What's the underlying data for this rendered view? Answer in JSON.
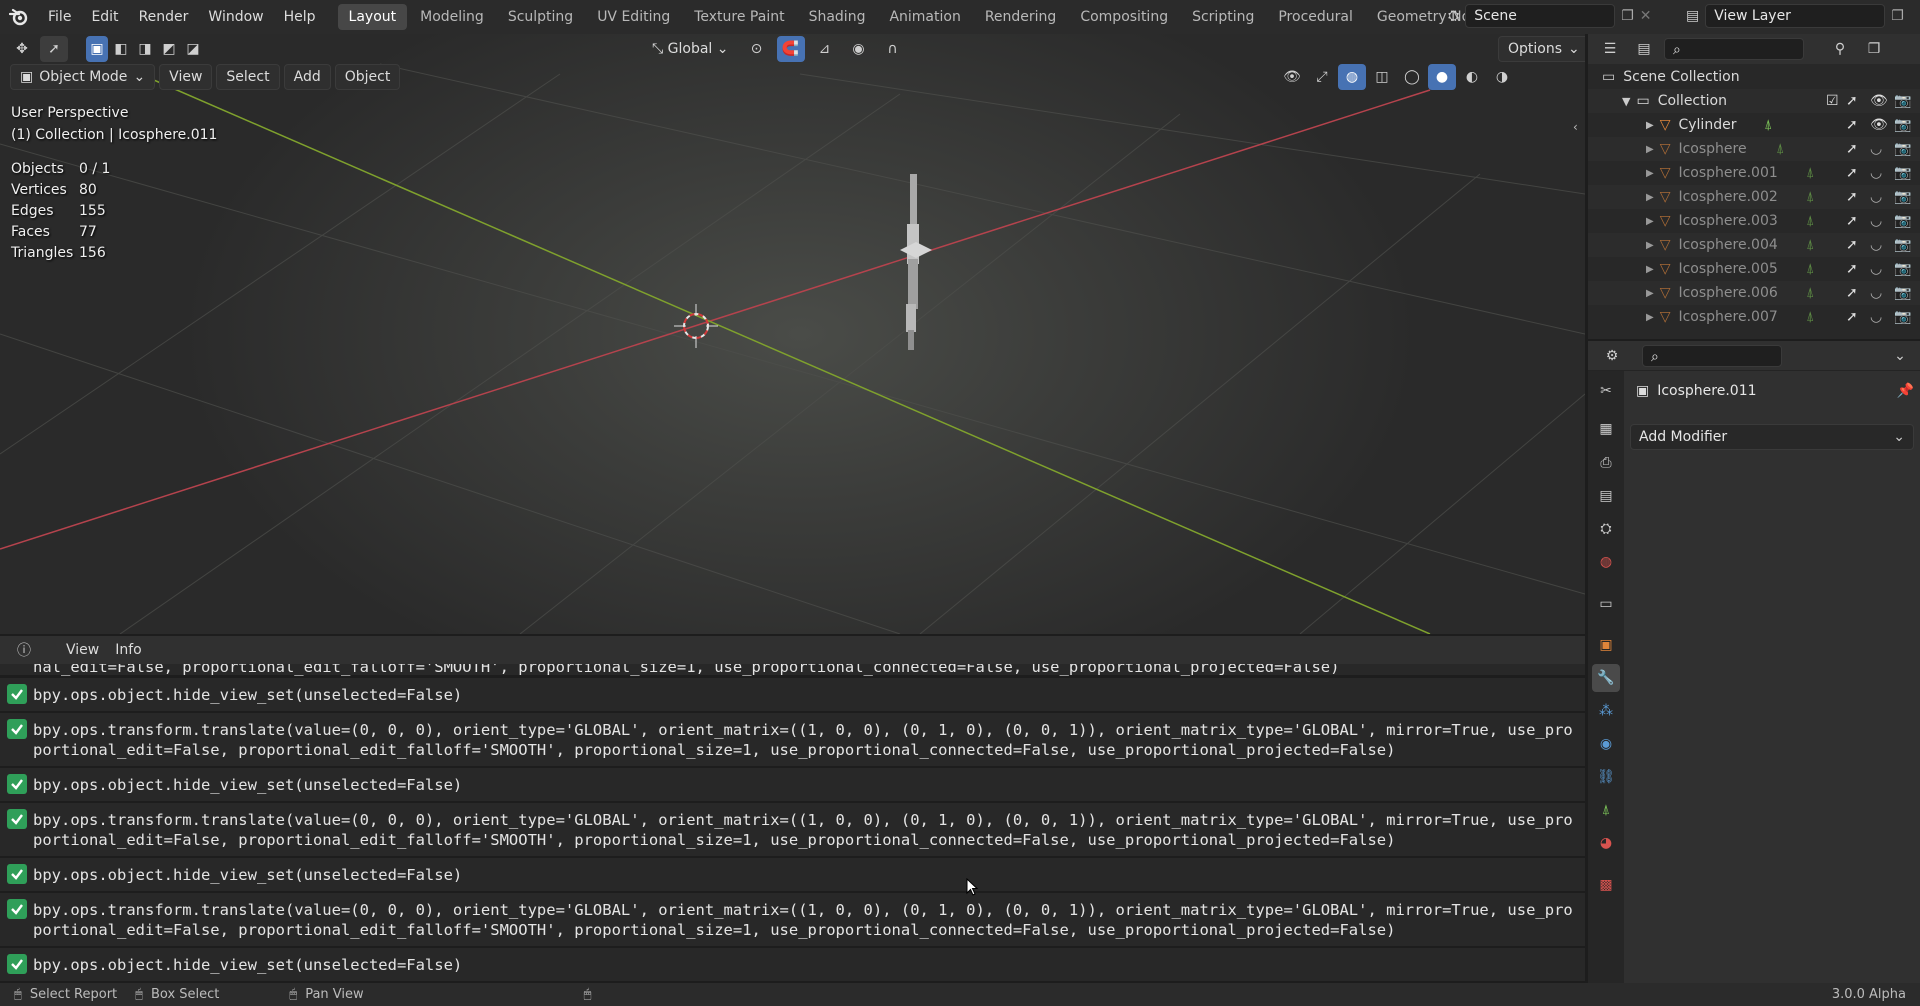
{
  "topbar": {
    "menus": [
      "File",
      "Edit",
      "Render",
      "Window",
      "Help"
    ],
    "workspaces": [
      "Layout",
      "Modeling",
      "Sculpting",
      "UV Editing",
      "Texture Paint",
      "Shading",
      "Animation",
      "Rendering",
      "Compositing",
      "Scripting",
      "Procedural",
      "Geometry Nodes"
    ],
    "active_workspace": "Layout",
    "scene": "Scene",
    "view_layer": "View Layer"
  },
  "viewport": {
    "transform_orientation": "Global",
    "options_label": "Options",
    "mode": "Object Mode",
    "header_menus": [
      "View",
      "Select",
      "Add",
      "Object"
    ],
    "perspective": "User Perspective",
    "context": "(1) Collection | Icosphere.011",
    "stats": [
      {
        "label": "Objects",
        "value": "0 / 1"
      },
      {
        "label": "Vertices",
        "value": "80"
      },
      {
        "label": "Edges",
        "value": "155"
      },
      {
        "label": "Faces",
        "value": "77"
      },
      {
        "label": "Triangles",
        "value": "156"
      }
    ]
  },
  "info_editor": {
    "header_menus": [
      "View",
      "Info"
    ],
    "partial_line": "nal_edit=False, proportional_edit_falloff='SMOOTH', proportional_size=1, use_proportional_connected=False, use_proportional_projected=False)",
    "reports": [
      "bpy.ops.object.hide_view_set(unselected=False)",
      "bpy.ops.transform.translate(value=(0, 0, 0), orient_type='GLOBAL', orient_matrix=((1, 0, 0), (0, 1, 0), (0, 0, 1)), orient_matrix_type='GLOBAL', mirror=True, use_proportional_edit=False, proportional_edit_falloff='SMOOTH', proportional_size=1, use_proportional_connected=False, use_proportional_projected=False)",
      "bpy.ops.object.hide_view_set(unselected=False)",
      "bpy.ops.transform.translate(value=(0, 0, 0), orient_type='GLOBAL', orient_matrix=((1, 0, 0), (0, 1, 0), (0, 0, 1)), orient_matrix_type='GLOBAL', mirror=True, use_proportional_edit=False, proportional_edit_falloff='SMOOTH', proportional_size=1, use_proportional_connected=False, use_proportional_projected=False)",
      "bpy.ops.object.hide_view_set(unselected=False)",
      "bpy.ops.transform.translate(value=(0, 0, 0), orient_type='GLOBAL', orient_matrix=((1, 0, 0), (0, 1, 0), (0, 0, 1)), orient_matrix_type='GLOBAL', mirror=True, use_proportional_edit=False, proportional_edit_falloff='SMOOTH', proportional_size=1, use_proportional_connected=False, use_proportional_projected=False)",
      "bpy.ops.object.hide_view_set(unselected=False)"
    ]
  },
  "outliner": {
    "scene_collection": "Scene Collection",
    "collection": "Collection",
    "objects": [
      {
        "name": "Cylinder",
        "visible": true,
        "dim": false
      },
      {
        "name": "Icosphere",
        "visible": false,
        "dim": true
      },
      {
        "name": "Icosphere.001",
        "visible": false,
        "dim": true
      },
      {
        "name": "Icosphere.002",
        "visible": false,
        "dim": true
      },
      {
        "name": "Icosphere.003",
        "visible": false,
        "dim": true
      },
      {
        "name": "Icosphere.004",
        "visible": false,
        "dim": true
      },
      {
        "name": "Icosphere.005",
        "visible": false,
        "dim": true
      },
      {
        "name": "Icosphere.006",
        "visible": false,
        "dim": true
      },
      {
        "name": "Icosphere.007",
        "visible": false,
        "dim": true
      }
    ]
  },
  "properties": {
    "object_name": "Icosphere.011",
    "add_modifier": "Add Modifier"
  },
  "statusbar": {
    "select_report": "Select Report",
    "box_select": "Box Select",
    "pan_view": "Pan View",
    "version": "3.0.0 Alpha"
  },
  "colors": {
    "accent": "#4772b3",
    "x_axis": "#b5434d",
    "y_axis": "#7fa12d",
    "report_ok": "#2f9f59",
    "object_orange": "#e0853a"
  }
}
